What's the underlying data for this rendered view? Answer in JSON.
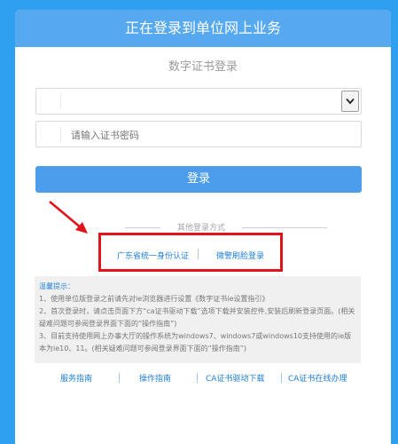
{
  "header": {
    "title": "正在登录到单位网上业务"
  },
  "form": {
    "subtitle": "数字证书登录",
    "certificate_select_value": "",
    "password_placeholder": "请输入证书密码",
    "login_label": "登录"
  },
  "other_login": {
    "title": "其他登录方式",
    "options": [
      {
        "label": "广东省统一身份认证"
      },
      {
        "label": "微警刷脸登录"
      }
    ]
  },
  "tips": {
    "title": "温馨提示：",
    "items": [
      "1、使用单位版登录之前请先对ie浏览器进行设置《数字证书ie设置指引》",
      "2、首次登录时，请点击页面下方“ca证书驱动下载”选项下载并安装控件,安装后刷新登录页面。(相关疑难问题可参阅登录界面下面的“操作指南”)",
      "3、目前支持使用网上办事大厅的操作系统为windows7、windows7或windows10支持使用的ie版本为ie10、11。(相关疑难问题可参阅登录界面下面的“操作指南”)"
    ]
  },
  "footer": {
    "links": [
      {
        "label": "服务指南"
      },
      {
        "label": "操作指南"
      },
      {
        "label": "CA证书驱动下载"
      },
      {
        "label": "CA证书在线办理"
      }
    ]
  },
  "colors": {
    "page_background": "#2fa0f0",
    "header_background": "#56a9ee",
    "login_button": "#4d9ded",
    "annotation_red": "#e0141a",
    "link_blue": "#1f7fd4"
  },
  "icons": {
    "select_arrow": "chevron-down-icon",
    "annotation_arrow": "red-arrow-icon"
  }
}
